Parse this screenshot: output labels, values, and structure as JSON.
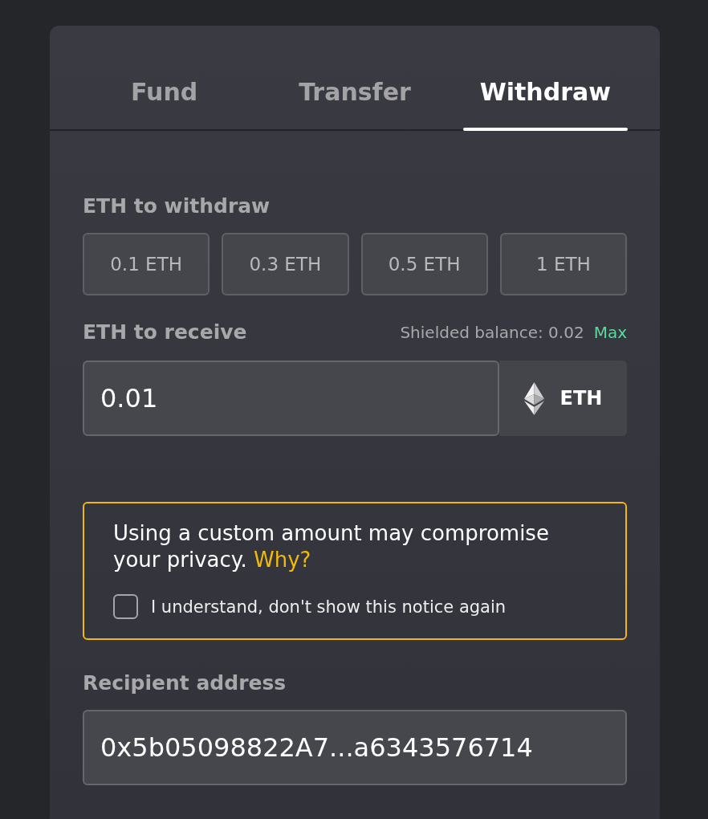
{
  "tabs": [
    {
      "label": "Fund",
      "selected": false
    },
    {
      "label": "Transfer",
      "selected": false
    },
    {
      "label": "Withdraw",
      "selected": true
    }
  ],
  "withdraw_amount": {
    "label": "ETH to withdraw",
    "presets": [
      {
        "label": "0.1 ETH",
        "selected": false
      },
      {
        "label": "0.3 ETH",
        "selected": false
      },
      {
        "label": "0.5 ETH",
        "selected": false
      },
      {
        "label": "1 ETH",
        "selected": false
      }
    ]
  },
  "receive": {
    "label": "ETH to receive",
    "balance": "Shielded balance: 0.02",
    "max_link": "Max",
    "value": "0.01",
    "currency": "ETH"
  },
  "notice": {
    "message": "Using a custom amount may compromise your privacy.",
    "link": "Why?",
    "checkbox": {
      "label": "I understand, don't show this notice again",
      "checked": false
    }
  },
  "recipient": {
    "label": "Recipient address",
    "value": "0x5b05098822A7...a6343576714"
  }
}
